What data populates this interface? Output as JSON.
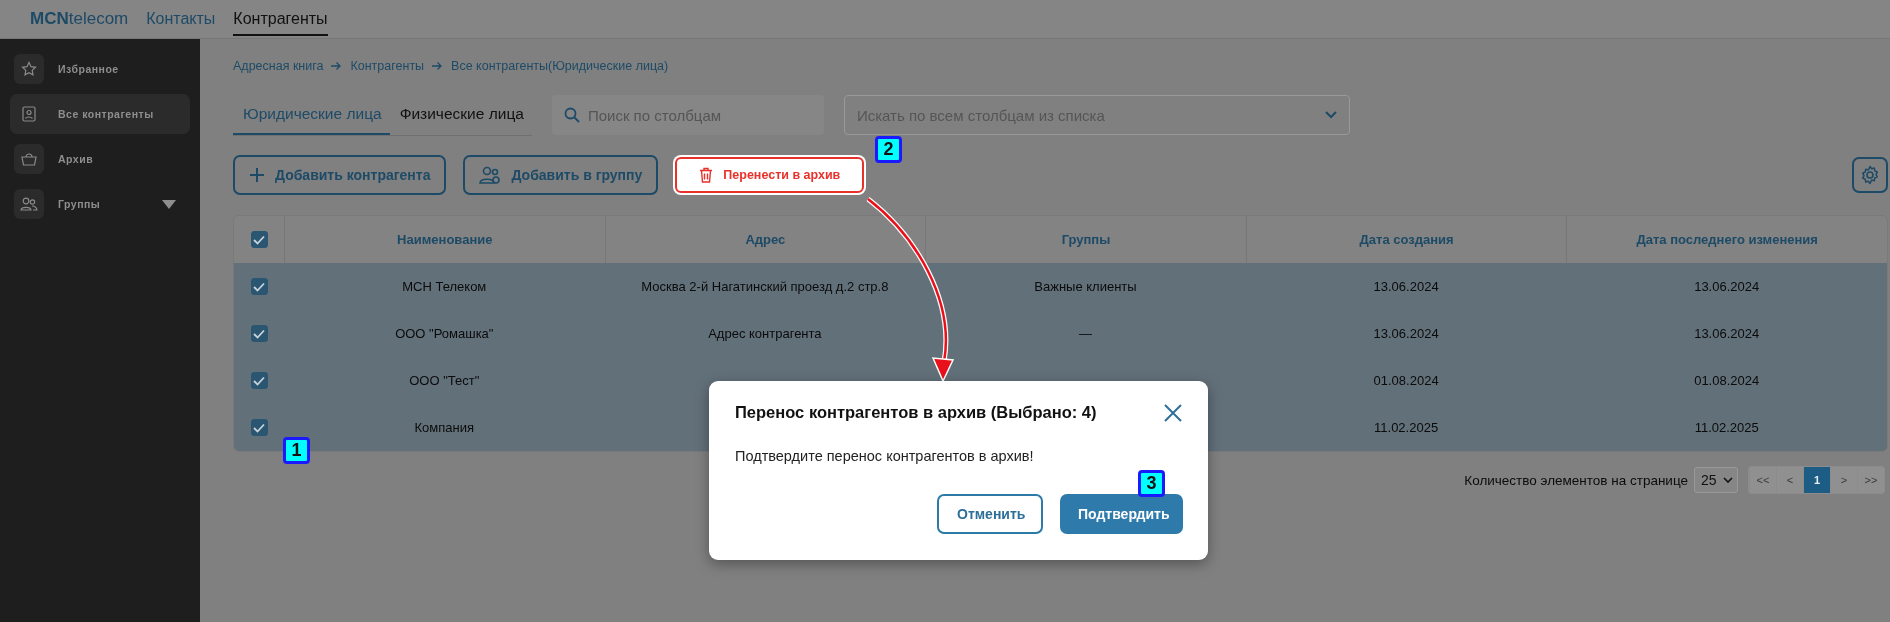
{
  "header": {
    "logo": {
      "bold": "MCN",
      "light": "telecom"
    },
    "nav": [
      {
        "label": "Контакты",
        "selected": false
      },
      {
        "label": "Контрагенты",
        "selected": true
      }
    ]
  },
  "sidebar": {
    "items": [
      {
        "label": "Избранное",
        "selected": false,
        "expandable": false
      },
      {
        "label": "Все контрагенты",
        "selected": true,
        "expandable": false
      },
      {
        "label": "Архив",
        "selected": false,
        "expandable": false
      },
      {
        "label": "Группы",
        "selected": false,
        "expandable": true
      }
    ]
  },
  "breadcrumb": [
    "Адресная книга",
    "Контрагенты",
    "Все контрагенты(Юридические лица)"
  ],
  "tabs": [
    {
      "label": "Юридические лица",
      "selected": true
    },
    {
      "label": "Физические лица",
      "selected": false
    }
  ],
  "search": {
    "placeholder": "Поиск по столбцам"
  },
  "column_filter": {
    "placeholder": "Искать по всем столбцам из списка"
  },
  "toolbar": {
    "buttons": [
      {
        "label": "Добавить контрагента",
        "kind": "add",
        "highlighted": false
      },
      {
        "label": "Добавить в группу",
        "kind": "group",
        "highlighted": false
      },
      {
        "label": "Перенести в архив",
        "kind": "archive",
        "highlighted": true
      }
    ]
  },
  "table": {
    "header_checked": true,
    "columns": [
      "Наименование",
      "Адрес",
      "Группы",
      "Дата создания",
      "Дата последнего изменения"
    ],
    "rows": [
      {
        "checked": true,
        "name": "МСН Телеком",
        "address": "Москва 2-й Нагатинский проезд д.2 стр.8",
        "groups": "Важные клиенты",
        "created": "13.06.2024",
        "modified": "13.06.2024"
      },
      {
        "checked": true,
        "name": "ООО \"Ромашка\"",
        "address": "Адрес контрагента",
        "groups": "—",
        "created": "13.06.2024",
        "modified": "13.06.2024"
      },
      {
        "checked": true,
        "name": "ООО \"Тест\"",
        "created": "01.08.2024",
        "modified": "01.08.2024"
      },
      {
        "checked": true,
        "name": "Компания",
        "created": "11.02.2025",
        "modified": "11.02.2025"
      }
    ]
  },
  "pagination": {
    "label": "Количество элементов на странице",
    "page_size": "25",
    "pages": [
      {
        "label": "<<",
        "selected": false
      },
      {
        "label": "<",
        "selected": false
      },
      {
        "label": "1",
        "selected": true
      },
      {
        "label": ">",
        "selected": false
      },
      {
        "label": ">>",
        "selected": false
      }
    ]
  },
  "dialog": {
    "title": "Перенос контрагентов в архив (Выбрано: 4)",
    "message": "Подтвердите перенос контрагентов в архив!",
    "buttons": [
      {
        "label": "Отменить",
        "kind": "secondary"
      },
      {
        "label": "Подтвердить",
        "kind": "primary"
      }
    ]
  },
  "callouts": [
    "1",
    "2",
    "3"
  ]
}
